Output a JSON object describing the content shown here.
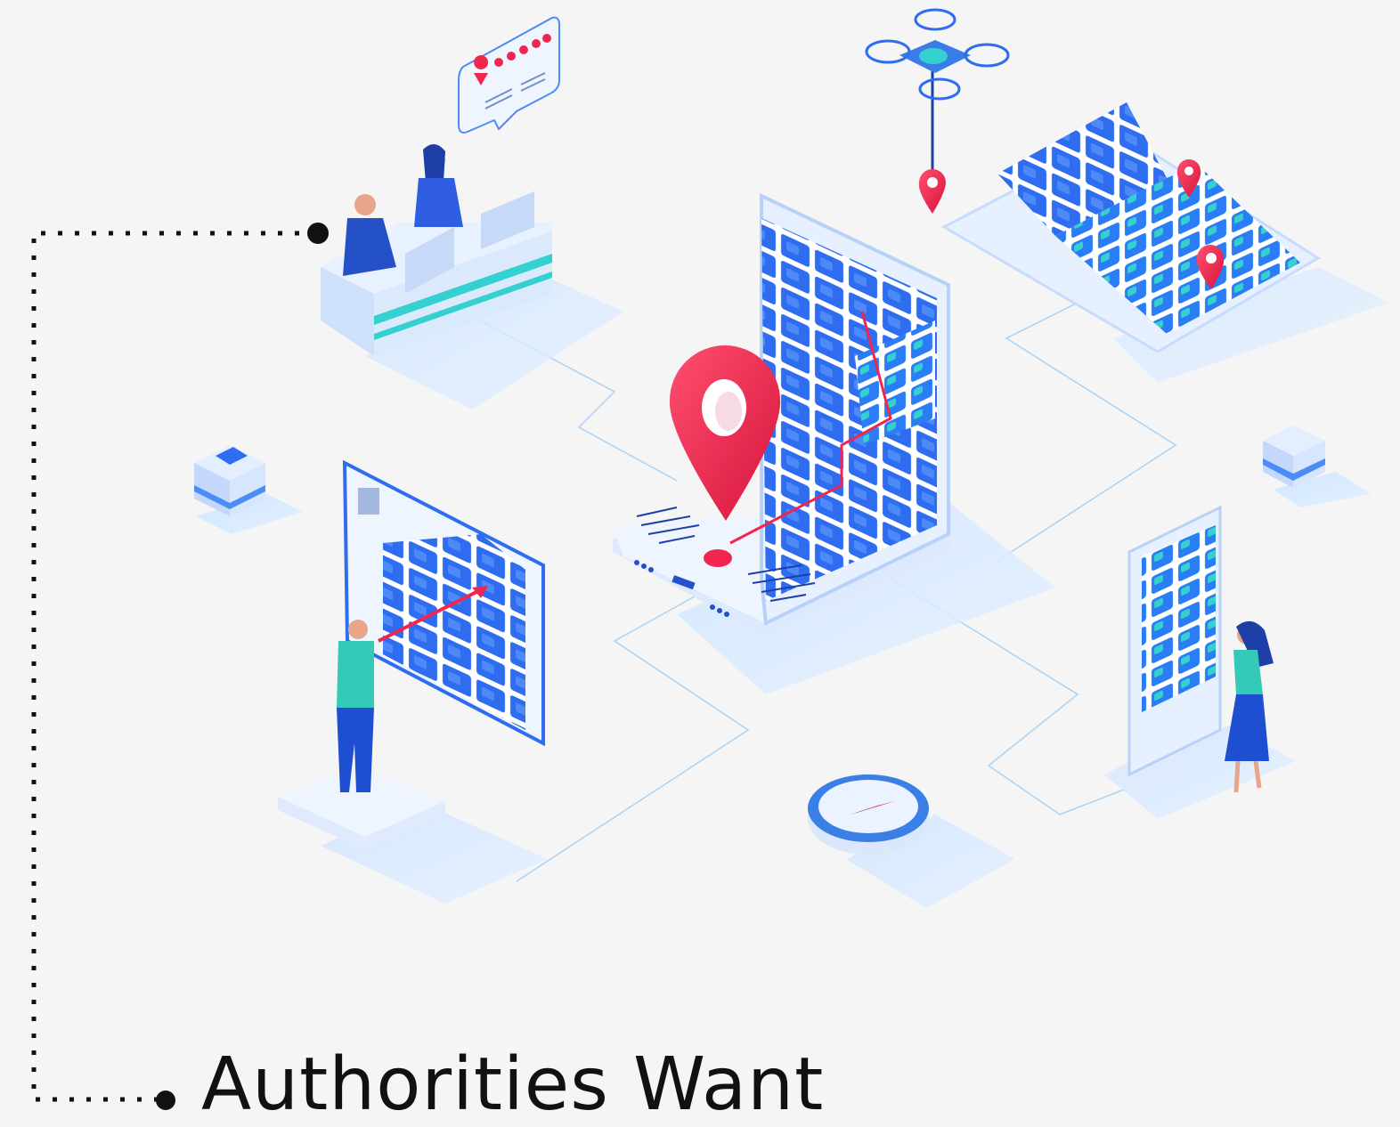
{
  "caption": "Authorities Want",
  "colors": {
    "background": "#f5f5f5",
    "primary_blue": "#2f6df0",
    "light_blue": "#cfe3fb",
    "teal": "#35d0d0",
    "pin_red": "#f0264f",
    "connector": "#111111"
  },
  "icons": [
    "drone-icon",
    "review-bubble-icon",
    "location-pin-icon",
    "compass-icon",
    "map-icon",
    "server-cube-icon"
  ]
}
